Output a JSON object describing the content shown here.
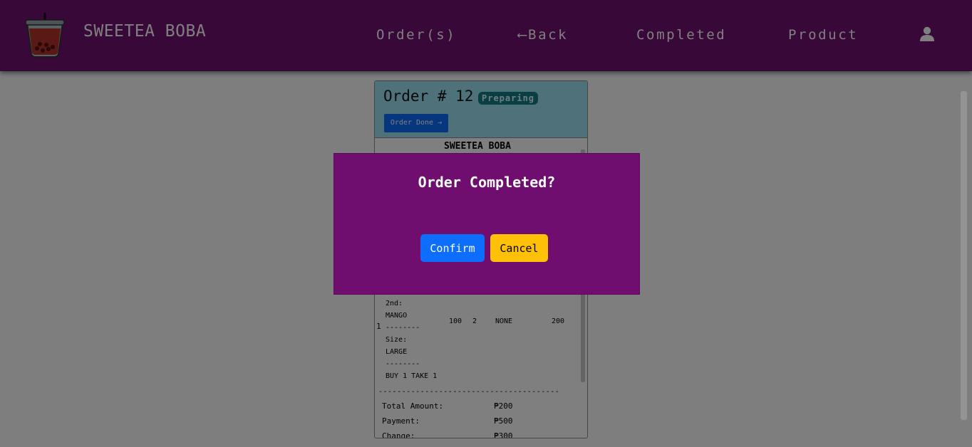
{
  "navbar": {
    "brand": "SWEETEA BOBA",
    "items": [
      "Order(s)",
      "⟵Back",
      "Completed",
      "Product"
    ],
    "icons": {
      "logo": "boba-cup-logo",
      "user": "user-icon"
    },
    "colors": {
      "background": "#711071",
      "text": "#ffffff"
    }
  },
  "order": {
    "title": "Order # 12",
    "status": "Preparing",
    "done_button": "Order Done →",
    "receipt": {
      "store": "SWEETEA BOBA",
      "row_number": "1",
      "item_lines": [
        "2nd:",
        "MANGO",
        "--------",
        "Size:",
        "LARGE",
        "--------",
        "BUY 1 TAKE 1"
      ],
      "price": "100",
      "qty": "2",
      "addon": "NONE",
      "total": "200",
      "divider": "---------------------------------------",
      "summary": [
        {
          "label": "Total Amount:",
          "value": "₱200"
        },
        {
          "label": "Payment:",
          "value": "₱500"
        },
        {
          "label": "Change:",
          "value": "₱300"
        }
      ]
    }
  },
  "modal": {
    "title": "Order Completed?",
    "confirm_label": "Confirm",
    "cancel_label": "Cancel",
    "colors": {
      "background": "#700e70",
      "confirm": "#0d6efd",
      "cancel": "#ffc107"
    }
  }
}
